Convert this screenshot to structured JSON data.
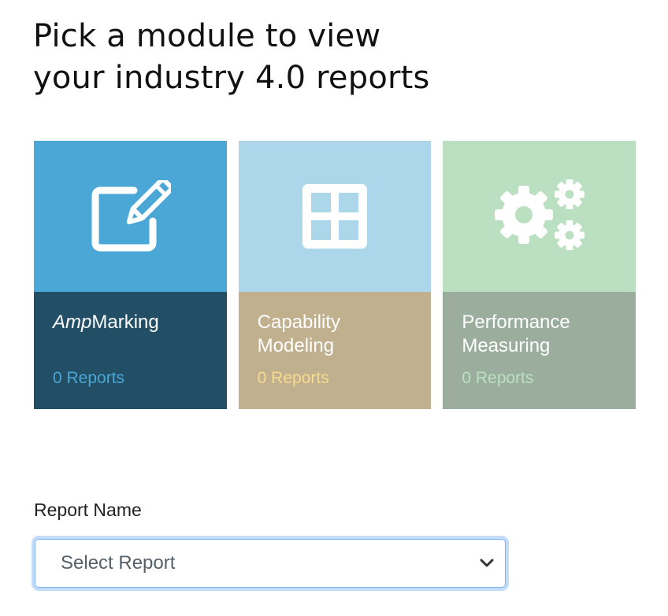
{
  "title": {
    "line1": "Pick a module to view",
    "line2": "your industry 4.0 reports"
  },
  "modules": [
    {
      "name_italic": "Amp",
      "name_rest": "Marking",
      "name_line2": "",
      "count": "0 Reports",
      "icon": "edit-icon",
      "colors": {
        "top": "#4aa7d6",
        "bottom": "#224e66",
        "count": "#4aa7d6"
      }
    },
    {
      "name": "Capability",
      "name_line2": "Modeling",
      "count": "0 Reports",
      "icon": "grid-icon",
      "colors": {
        "top": "#acd6ea",
        "bottom": "#c0b08e",
        "count": "#f5dc92"
      }
    },
    {
      "name": "Performance",
      "name_line2": "Measuring",
      "count": "0 Reports",
      "icon": "gears-icon",
      "colors": {
        "top": "#bbe0c1",
        "bottom": "#9bae9e",
        "count": "#bbe0c1"
      }
    }
  ],
  "report": {
    "label": "Report Name",
    "select_value": "Select Report"
  }
}
